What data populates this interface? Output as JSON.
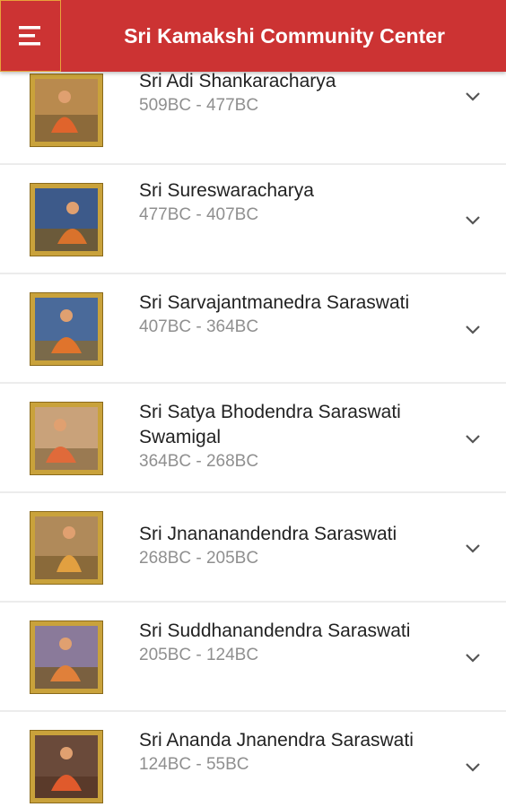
{
  "header": {
    "title": "Sri Kamakshi Community Center",
    "menu_icon": "hamburger-menu-icon",
    "background": "#cc3333"
  },
  "acharyas": [
    {
      "name": "Sri Adi Shankaracharya",
      "dates": "509BC - 477BC"
    },
    {
      "name": "Sri Sureswaracharya",
      "dates": "477BC - 407BC"
    },
    {
      "name": "Sri Sarvajantmanedra Saraswati",
      "dates": "407BC - 364BC"
    },
    {
      "name": "Sri Satya Bhodendra Saraswati Swamigal",
      "dates": "364BC - 268BC"
    },
    {
      "name": "Sri Jnananandendra Saraswati",
      "dates": "268BC - 205BC"
    },
    {
      "name": "Sri Suddhanandendra Saraswati",
      "dates": "205BC - 124BC"
    },
    {
      "name": "Sri Ananda Jnanendra Saraswati",
      "dates": "124BC - 55BC"
    }
  ]
}
